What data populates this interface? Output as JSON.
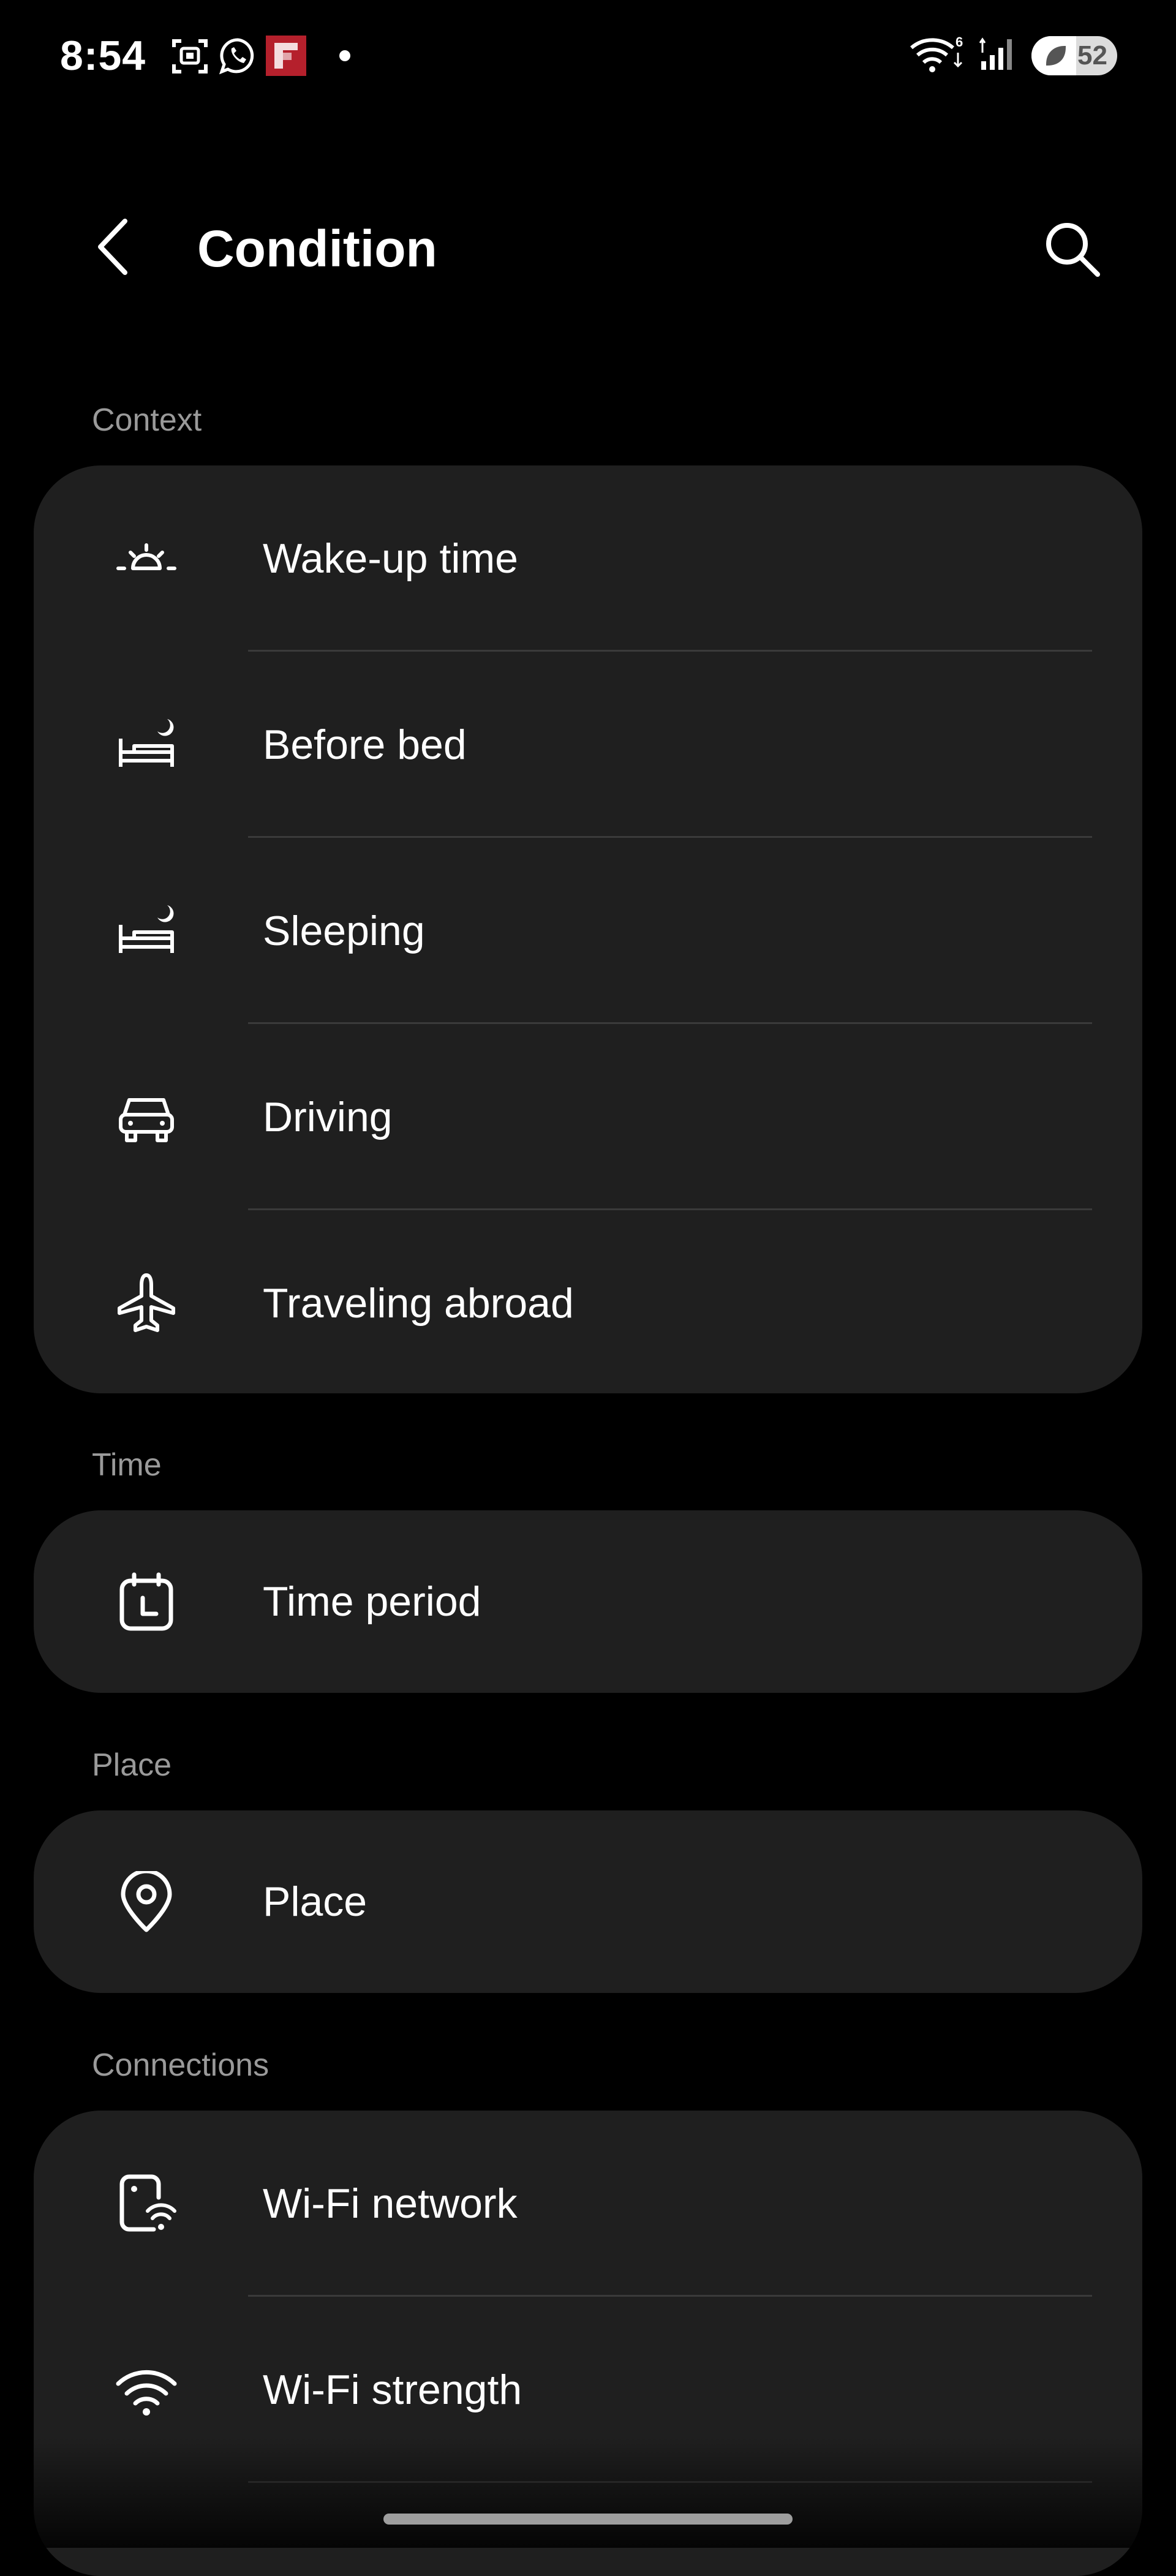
{
  "status_bar": {
    "time": "8:54",
    "battery_level": "52",
    "battery_fraction": 0.52,
    "icons_left": [
      "screen-recorder-icon",
      "whatsapp-icon",
      "flipboard-icon",
      "notification-dot-icon"
    ],
    "icons_right": [
      "wifi-6-icon",
      "cellular-signal-icon",
      "battery-saver-icon"
    ]
  },
  "app_bar": {
    "title": "Condition",
    "back_icon": "chevron-left-icon",
    "search_icon": "search-icon"
  },
  "sections": [
    {
      "header": "Context",
      "items": [
        {
          "label": "Wake-up time",
          "icon": "sunrise-icon"
        },
        {
          "label": "Before bed",
          "icon": "bed-moon-icon"
        },
        {
          "label": "Sleeping",
          "icon": "bed-moon-icon"
        },
        {
          "label": "Driving",
          "icon": "car-icon"
        },
        {
          "label": "Traveling abroad",
          "icon": "airplane-icon"
        }
      ]
    },
    {
      "header": "Time",
      "items": [
        {
          "label": "Time period",
          "icon": "calendar-clock-icon"
        }
      ]
    },
    {
      "header": "Place",
      "items": [
        {
          "label": "Place",
          "icon": "location-pin-icon"
        }
      ]
    },
    {
      "header": "Connections",
      "items": [
        {
          "label": "Wi-Fi network",
          "icon": "phone-wifi-icon"
        },
        {
          "label": "Wi-Fi strength",
          "icon": "wifi-icon"
        }
      ]
    }
  ],
  "colors": {
    "background": "#000000",
    "card": "#1f1f1f",
    "section_header": "#9a9a9a",
    "divider": "#3a3a3a",
    "text": "#ffffff"
  }
}
